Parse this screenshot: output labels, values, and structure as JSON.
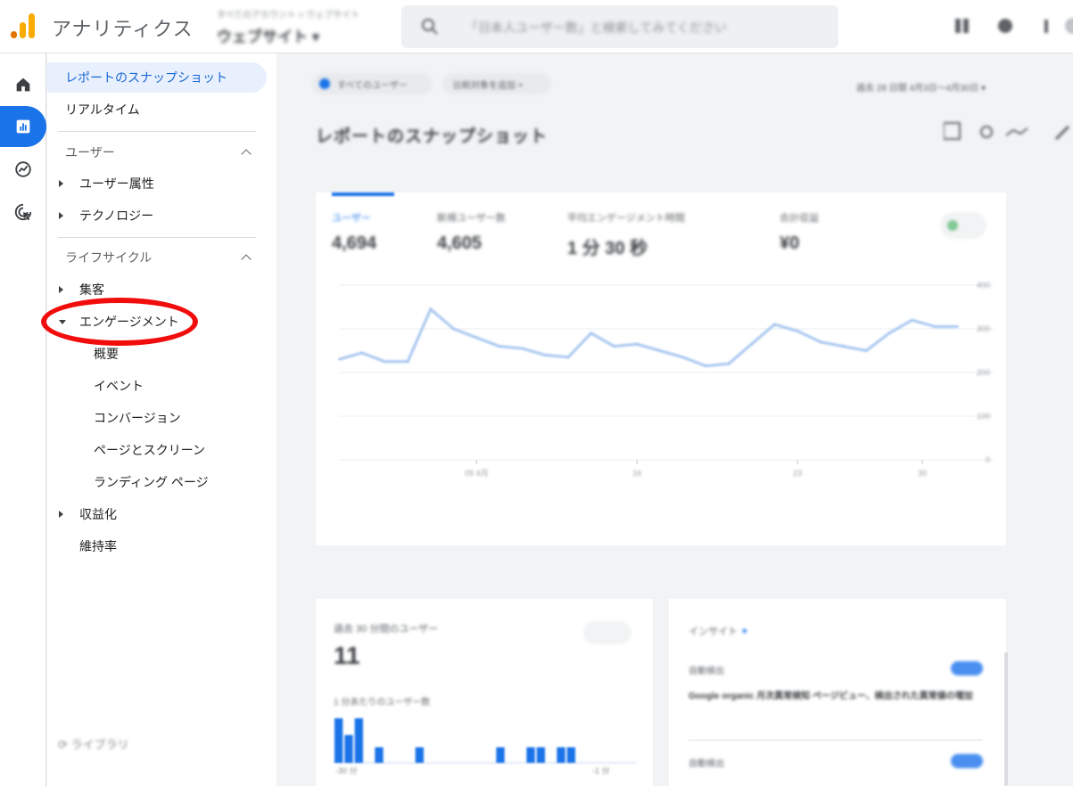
{
  "header": {
    "app_title": "アナリティクス",
    "account_small": "すべてのアカウント > ウェブサイト",
    "account_name": "ウェブサイト ▾",
    "search_placeholder": "「日本人ユーザー数」と検索してみてください"
  },
  "rail": {
    "items": [
      {
        "name": "home",
        "icon": "home-icon"
      },
      {
        "name": "reports",
        "icon": "bar-chart-icon",
        "active": true
      },
      {
        "name": "explore",
        "icon": "explore-icon"
      },
      {
        "name": "advertising",
        "icon": "ads-cursor-icon"
      }
    ]
  },
  "nav": {
    "snapshot": "レポートのスナップショット",
    "realtime": "リアルタイム",
    "user_section": "ユーザー",
    "user_attributes": "ユーザー属性",
    "technology": "テクノロジー",
    "lifecycle_section": "ライフサイクル",
    "acquisition": "集客",
    "engagement": "エンゲージメント",
    "engagement_overview": "概要",
    "engagement_events": "イベント",
    "engagement_conversions": "コンバージョン",
    "engagement_pages": "ページとスクリーン",
    "engagement_landing": "ランディング ページ",
    "monetization": "収益化",
    "retention": "維持率",
    "library": "ライブラリ"
  },
  "main": {
    "chip_all_users": "すべてのユーザー",
    "chip_add_comparison": "比較対象を追加 +",
    "date_range": "過去 28 日間 4月3日～4月30日 ▾",
    "page_title": "レポートのスナップショット",
    "metrics": [
      {
        "label": "ユーザー",
        "value": "4,694"
      },
      {
        "label": "新規ユーザー数",
        "value": "4,605"
      },
      {
        "label": "平均エンゲージメント時間",
        "value": "1 分 30 秒"
      },
      {
        "label": "合計収益",
        "value": "¥0"
      }
    ],
    "y_ticks": [
      "400",
      "300",
      "200",
      "100",
      "0"
    ],
    "x_ticks": [
      "09 4月",
      "16",
      "23",
      "30"
    ],
    "realtime_card": {
      "label": "過去 30 分間のユーザー",
      "value": "11",
      "sub": "1 分あたりのユーザー数",
      "x_left": "-30 分",
      "x_right": "-1 分"
    },
    "insights_card": {
      "title": "インサイト",
      "rows": [
        {
          "head": "自動検出",
          "body": "Google organic 月次異常検知 ページビュー、検出された異常値の増加"
        },
        {
          "head": "自動検出",
          "body": ""
        }
      ]
    }
  },
  "chart_data": {
    "type": "line",
    "title": "",
    "xlabel": "",
    "ylabel": "",
    "ylim": [
      0,
      400
    ],
    "x": [
      1,
      2,
      3,
      4,
      5,
      6,
      7,
      8,
      9,
      10,
      11,
      12,
      13,
      14,
      15,
      16,
      17,
      18,
      19,
      20,
      21,
      22,
      23,
      24,
      25,
      26,
      27,
      28
    ],
    "series": [
      {
        "values": [
          230,
          245,
          225,
          225,
          345,
          300,
          280,
          260,
          255,
          240,
          235,
          290,
          260,
          265,
          250,
          235,
          215,
          220,
          265,
          310,
          295,
          270,
          260,
          250,
          290,
          320,
          305,
          305
        ]
      }
    ]
  },
  "mini_chart_data": {
    "type": "bar",
    "values": [
      40,
      25,
      40,
      0,
      14,
      0,
      0,
      0,
      14,
      0,
      0,
      0,
      0,
      0,
      0,
      0,
      14,
      0,
      0,
      14,
      14,
      0,
      14,
      14,
      0,
      0,
      0,
      0,
      0,
      0
    ]
  },
  "colors": {
    "accent": "#1a73e8",
    "selected_bg": "#e8f0fe",
    "highlight_ring": "#f20d0d",
    "line": "#a8c7f0"
  }
}
